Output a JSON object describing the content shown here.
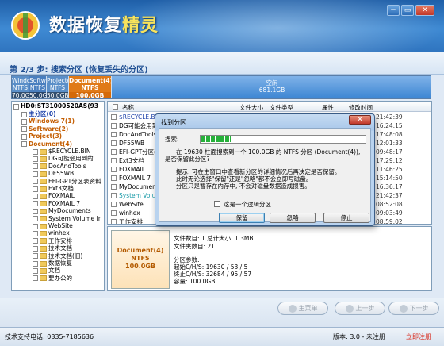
{
  "app": {
    "title_part1": "数据恢复",
    "title_part2": "精灵"
  },
  "window": {
    "minimize": "─",
    "restore": "▭",
    "close": "✕"
  },
  "step": {
    "label": "第 2/3 步: 搜索分区 (恢复丢失的分区)"
  },
  "partitions": [
    {
      "name": "Windows 7(1)",
      "fs": "NTFS",
      "size": "70.0GB"
    },
    {
      "name": "Softwar",
      "fs": "NTFS",
      "size": "50.0G"
    },
    {
      "name": "Project(3)",
      "fs": "NTFS",
      "size": "50.0GB"
    },
    {
      "name": "Document(4)",
      "fs": "NTFS",
      "size": "100.0GB"
    },
    {
      "name": "空闲",
      "fs": "",
      "size": "681.1GB"
    }
  ],
  "tree": {
    "root": "HD0:ST31000520AS(93",
    "items": [
      {
        "label": "主分区(0)",
        "style": "blue"
      },
      {
        "label": "Windows 7(1)",
        "style": "orange"
      },
      {
        "label": "Software(2)",
        "style": "orange"
      },
      {
        "label": "Project(3)",
        "style": "orange"
      },
      {
        "label": "Document(4)",
        "style": "orange"
      },
      {
        "label": "$RECYCLE.BIN",
        "style": ""
      },
      {
        "label": "DG可能会用到的",
        "style": ""
      },
      {
        "label": "DocAndTools",
        "style": ""
      },
      {
        "label": "DF55WB",
        "style": ""
      },
      {
        "label": "EFI-GPT分区表资料",
        "style": ""
      },
      {
        "label": "Ext3文档",
        "style": ""
      },
      {
        "label": "FOXMAIL",
        "style": ""
      },
      {
        "label": "FOXMAIL 7",
        "style": ""
      },
      {
        "label": "MyDocuments",
        "style": ""
      },
      {
        "label": "System Volume In",
        "style": ""
      },
      {
        "label": "WebSite",
        "style": ""
      },
      {
        "label": "winhex",
        "style": ""
      },
      {
        "label": "工作安排",
        "style": ""
      },
      {
        "label": "技术文档",
        "style": ""
      },
      {
        "label": "技术文档(旧)",
        "style": ""
      },
      {
        "label": "数据恢复",
        "style": ""
      },
      {
        "label": "文档",
        "style": ""
      },
      {
        "label": "要办公的",
        "style": ""
      }
    ]
  },
  "filelist": {
    "columns": {
      "name": "名称",
      "size": "文件大小",
      "type": "文件类型",
      "attr": "属性",
      "mtime": "修改时间"
    },
    "rows": [
      {
        "name": "$RECYCLE.BIN",
        "time": "21:42:39",
        "color": "#1a3fa8"
      },
      {
        "name": "DG可能会用到",
        "time": "16:24:15",
        "color": "#000"
      },
      {
        "name": "DocAndTools",
        "time": "17:48:08",
        "color": "#000"
      },
      {
        "name": "DF55WB",
        "time": "12:01:33",
        "color": "#000"
      },
      {
        "name": "EFI-GPT分区表",
        "time": "09:48:17",
        "color": "#000"
      },
      {
        "name": "Ext3文档",
        "time": "17:29:12",
        "color": "#000"
      },
      {
        "name": "FOXMAIL",
        "time": "11:46:25",
        "color": "#000"
      },
      {
        "name": "FOXMAIL 7",
        "time": "15:14:50",
        "color": "#000"
      },
      {
        "name": "MyDocuments",
        "time": "16:36:17",
        "color": "#000"
      },
      {
        "name": "System Volume",
        "time": "21:42:37",
        "color": "#1a9ba8"
      },
      {
        "name": "WebSite",
        "time": "08:52:08",
        "color": "#000"
      },
      {
        "name": "winhex",
        "time": "09:03:49",
        "color": "#000"
      },
      {
        "name": "工作安排",
        "time": "08:59:02",
        "color": "#000"
      }
    ]
  },
  "info": {
    "card_name": "Document(4)",
    "card_fs": "NTFS",
    "card_size": "100.0GB",
    "line1": "文件数目: 1 总计大小: 1.3MB",
    "line2": "文件夹数目: 21",
    "line3": "分区参数:",
    "line4": "起始C/H/S:     19630 /  53 /   5",
    "line5": "终止C/H/S:     32684 /  95 /  57",
    "line6": "容量: 100.0GB"
  },
  "nav": {
    "main_menu": "主菜单",
    "prev": "上一步",
    "next": "下一步"
  },
  "status": {
    "support": "技术支持电话: 0335-7185636",
    "version": "版本: 3.0 - 未注册",
    "register": "立即注册"
  },
  "dialog": {
    "title": "找到分区",
    "close": "✕",
    "search_label": "搜索:",
    "progress": 0.18,
    "msg1": "在 19630 柱面搜索到一个 100.0GB 的 NTFS 分区 (Document(4)),",
    "msg2": "是否保留此分区?",
    "tip1": "提示: 可在主窗口中查看新分区的详细情况后再决定是否保留。",
    "tip2": "此时无论选择\"保留\"还是\"忽略\"都不会立即写磁盘。",
    "tip3": "分区只是暂存在内存中, 不会对磁盘数据造成损害。",
    "checkbox": "这是一个逻辑分区",
    "keep": "保留",
    "ignore": "忽略",
    "stop": "停止"
  }
}
